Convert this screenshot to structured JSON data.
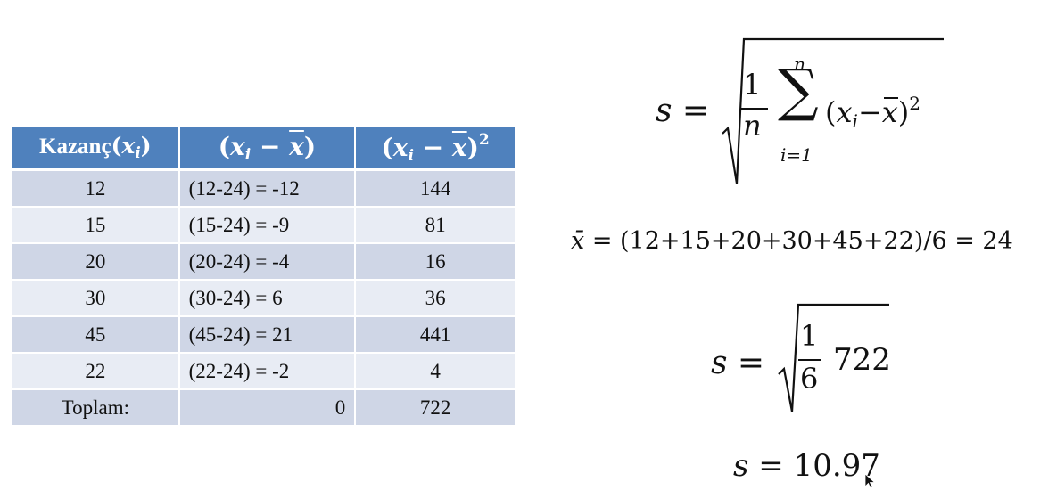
{
  "colors": {
    "header_bg": "#4f81bd",
    "row_dark": "#cfd6e6",
    "row_light": "#e8ecf4",
    "text": "#111111"
  },
  "table": {
    "header": {
      "col1_label": "Kazanç",
      "col1_var": "x",
      "col1_sub": "i",
      "col2_var": "x",
      "col2_sub": "i",
      "col2_minus": "−",
      "col2_bar": "x",
      "col3_var": "x",
      "col3_sub": "i",
      "col3_minus": "−",
      "col3_bar": "x",
      "col3_exp": "2"
    },
    "rows": [
      {
        "x": "12",
        "diff": "(12-24) = -12",
        "sq": "144"
      },
      {
        "x": "15",
        "diff": "(15-24) = -9",
        "sq": "81"
      },
      {
        "x": "20",
        "diff": "(20-24) = -4",
        "sq": "16"
      },
      {
        "x": "30",
        "diff": "(30-24) = 6",
        "sq": "36"
      },
      {
        "x": "45",
        "diff": "(45-24) = 21",
        "sq": "441"
      },
      {
        "x": "22",
        "diff": "(22-24) = -2",
        "sq": "4"
      }
    ],
    "total": {
      "label": "Toplam:",
      "diff": "0",
      "sq": "722"
    }
  },
  "formulas": {
    "std_def": {
      "lhs": "s =",
      "frac_num": "1",
      "frac_den": "n",
      "sum_top": "n",
      "sum_symbol": "∑",
      "sum_bottom": "i=1",
      "body_open": "(",
      "body_var": "x",
      "body_sub": "i",
      "body_minus": "−",
      "body_bar": "x",
      "body_close": ")",
      "body_exp": "2"
    },
    "mean": {
      "lhs": "x̄",
      "rhs": " = (12+15+20+30+45+22)/6 = 24"
    },
    "std_sub": {
      "lhs": "s =",
      "frac_num": "1",
      "frac_den": "6",
      "value": "722"
    },
    "result": {
      "var": "s",
      "rhs": " = 10.97"
    }
  }
}
